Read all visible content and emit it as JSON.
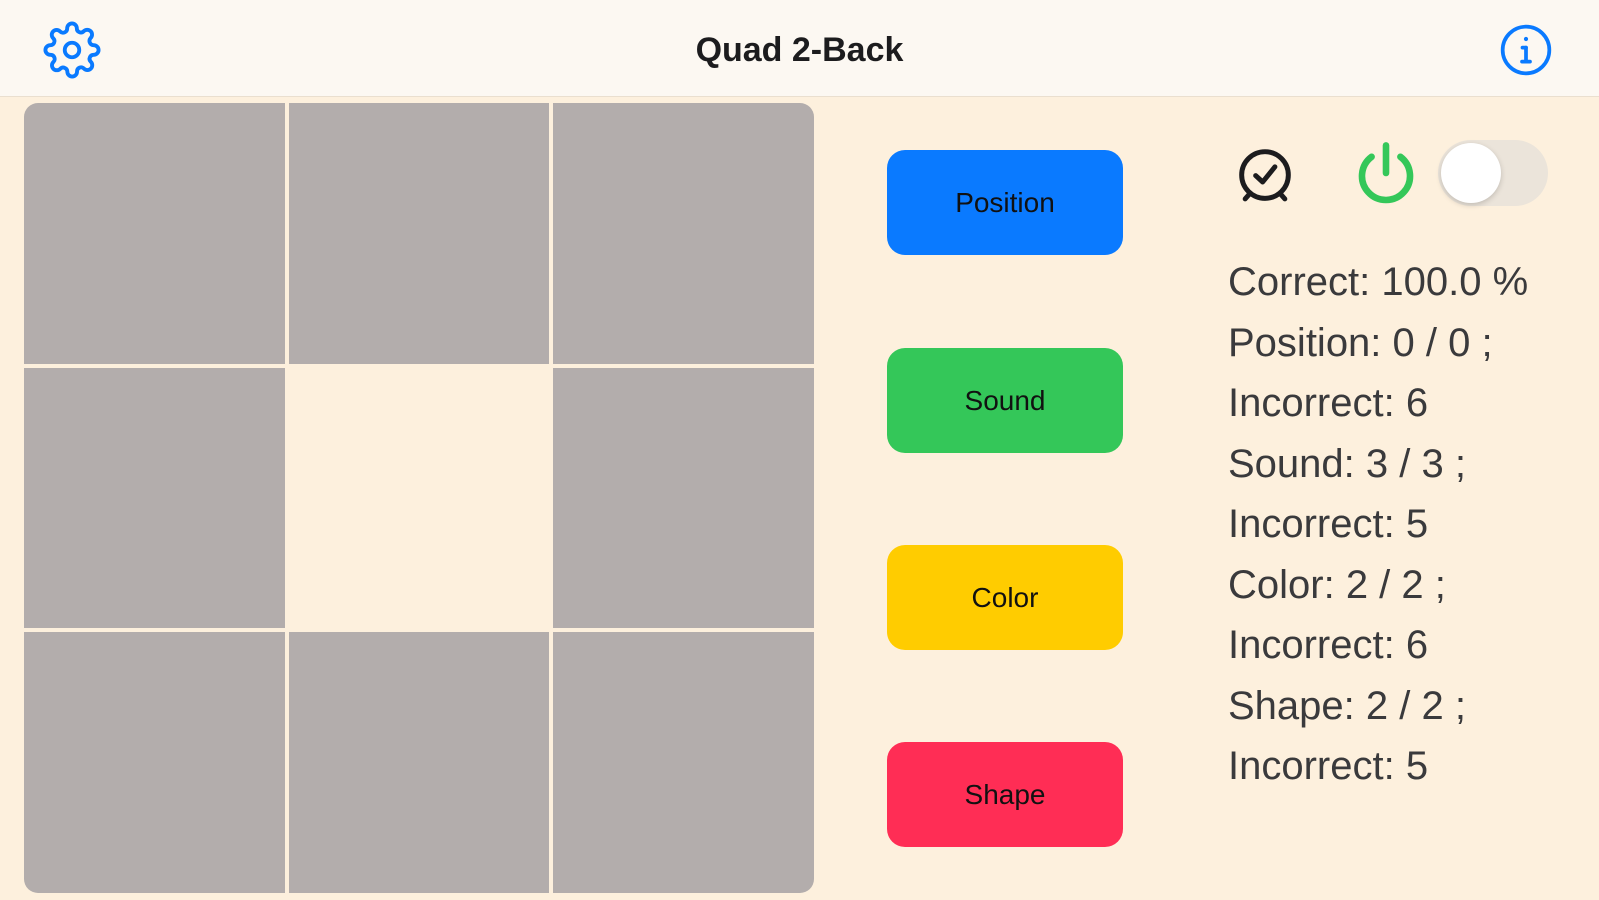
{
  "app": {
    "title": "Quad 2-Back",
    "settings_icon": "gear-icon",
    "info_icon": "info-circle-icon",
    "accent_color": "#0a7aff"
  },
  "grid": {
    "rows": 3,
    "cols": 3,
    "active_cell": 4,
    "cell_color": "#b3adac",
    "active_color": "#fdf0dd"
  },
  "buttons": [
    {
      "label": "Position",
      "color": "#0a7aff"
    },
    {
      "label": "Sound",
      "color": "#34c759"
    },
    {
      "label": "Color",
      "color": "#ffcc00"
    },
    {
      "label": "Shape",
      "color": "#ff2d55"
    }
  ],
  "controls": {
    "timer_icon": "alarm-clock-icon",
    "power_icon": "power-icon",
    "power_color": "#34c759",
    "toggle_on": false
  },
  "stats": [
    "Correct: 100.0 %",
    "Position: 0 / 0 ;",
    "Incorrect: 6",
    "Sound: 3 / 3 ;",
    "Incorrect: 5",
    "Color: 2 / 2 ;",
    "Incorrect: 6",
    "Shape: 2 / 2 ;",
    "Incorrect: 5"
  ]
}
